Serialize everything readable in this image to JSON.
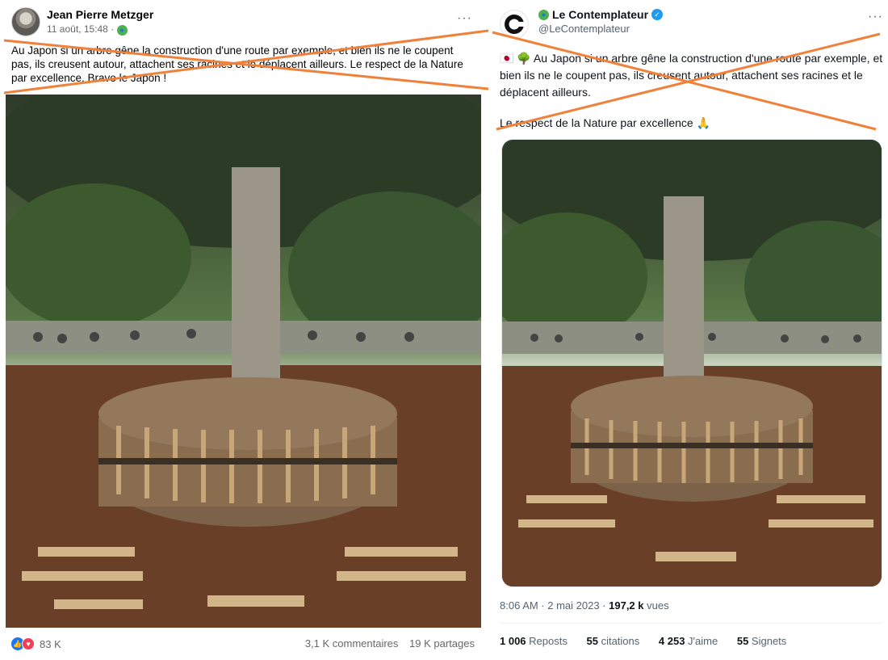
{
  "facebook_post": {
    "author": "Jean Pierre Metzger",
    "date": "11 août, 15:48",
    "audience_icon": "globe-icon",
    "more_icon": "more-options-icon",
    "text": "Au Japon si un arbre gêne la construction d'une route par exemple, et bien ils ne le coupent pas, ils creusent autour, attachent ses racines et le déplacent ailleurs. Le respect de la Nature par excellence. Bravo le Japon !",
    "reactions_count": "83 K",
    "comments": "3,1 K commentaires",
    "shares": "19 K partages"
  },
  "x_post": {
    "author": "Le Contemplateur",
    "handle": "@LeContemplateur",
    "verified_icon": "verified-badge-icon",
    "text_line1": "🇯🇵 🌳 Au Japon si un arbre gêne la construction d'une route par exemple, et bien ils ne le coupent pas, ils creusent autour, attachent ses racines et le déplacent ailleurs.",
    "text_line2": "Le respect de la Nature par excellence 🙏",
    "time": "8:06 AM · 2 mai 2023 · ",
    "views_count": "197,2 k",
    "views_label": " vues",
    "reposts_count": "1 006",
    "reposts_label": " Reposts",
    "quotes_count": "55",
    "quotes_label": " citations",
    "likes_count": "4 253",
    "likes_label": " J'aime",
    "bookmarks_count": "55",
    "bookmarks_label": " Signets"
  },
  "colors": {
    "strike": "#f0813a",
    "fb_blue": "#1877f2",
    "x_blue": "#1d9bf0"
  }
}
